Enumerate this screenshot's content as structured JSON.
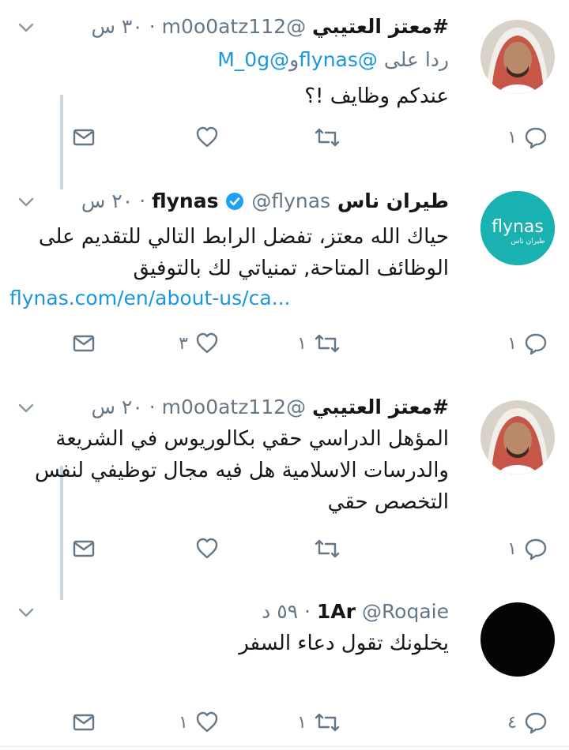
{
  "tweets": [
    {
      "name": "#معتز العتيبي",
      "handle": "@m0o0atz112",
      "time": "٣٠ س",
      "reply_prefix": "ردا على",
      "reply_mention1": "@flynas",
      "reply_join": "و",
      "reply_mention2": "@M_0g",
      "text": "عندكم وظايف !؟",
      "counts": {
        "reply": "١",
        "retweet": "",
        "like": ""
      },
      "avatar": "man-in-shemagh-avatar"
    },
    {
      "name": "طيران ناس flynas",
      "handle": "@flynas",
      "time": "٢٠ س",
      "verified": true,
      "text": "حياك الله معتز، تفضل الرابط التالي للتقديم على الوظائف المتاحة, تمنياتي لك بالتوفيق",
      "link": "flynas.com/en/about-us/ca...",
      "counts": {
        "reply": "١",
        "retweet": "١",
        "like": "٣"
      },
      "avatar": "flynas-logo",
      "logo_text": "flynas",
      "logo_subtext": "طيران ناس",
      "brand_color": "#19b2b0"
    },
    {
      "name": "#معتز العتيبي",
      "handle": "@m0o0atz112",
      "time": "٢٠ س",
      "text": "المؤهل الدراسي حقي بكالوريوس في الشريعة والدرسات الاسلامية هل فيه مجال توظيفي لنفس التخصص حقي",
      "counts": {
        "reply": "١",
        "retweet": "",
        "like": ""
      },
      "avatar": "man-in-shemagh-avatar"
    },
    {
      "name": "1Ar",
      "handle": "@Roqaie",
      "time": "٥٩ د",
      "text": "يخلونك تقول دعاء السفر",
      "counts": {
        "reply": "٤",
        "retweet": "١",
        "like": "١"
      },
      "avatar": "black-circle-avatar"
    }
  ],
  "dot": "·",
  "icons": {
    "reply": "reply-icon",
    "retweet": "retweet-icon",
    "like": "heart-icon",
    "dm": "envelope-icon",
    "caret": "chevron-down-icon",
    "verified": "verified-badge-icon"
  },
  "colors": {
    "text": "#14171a",
    "muted": "#657786",
    "link": "#1b95e0",
    "verified": "#1da1f2",
    "thread_line": "#ccd6dd"
  }
}
